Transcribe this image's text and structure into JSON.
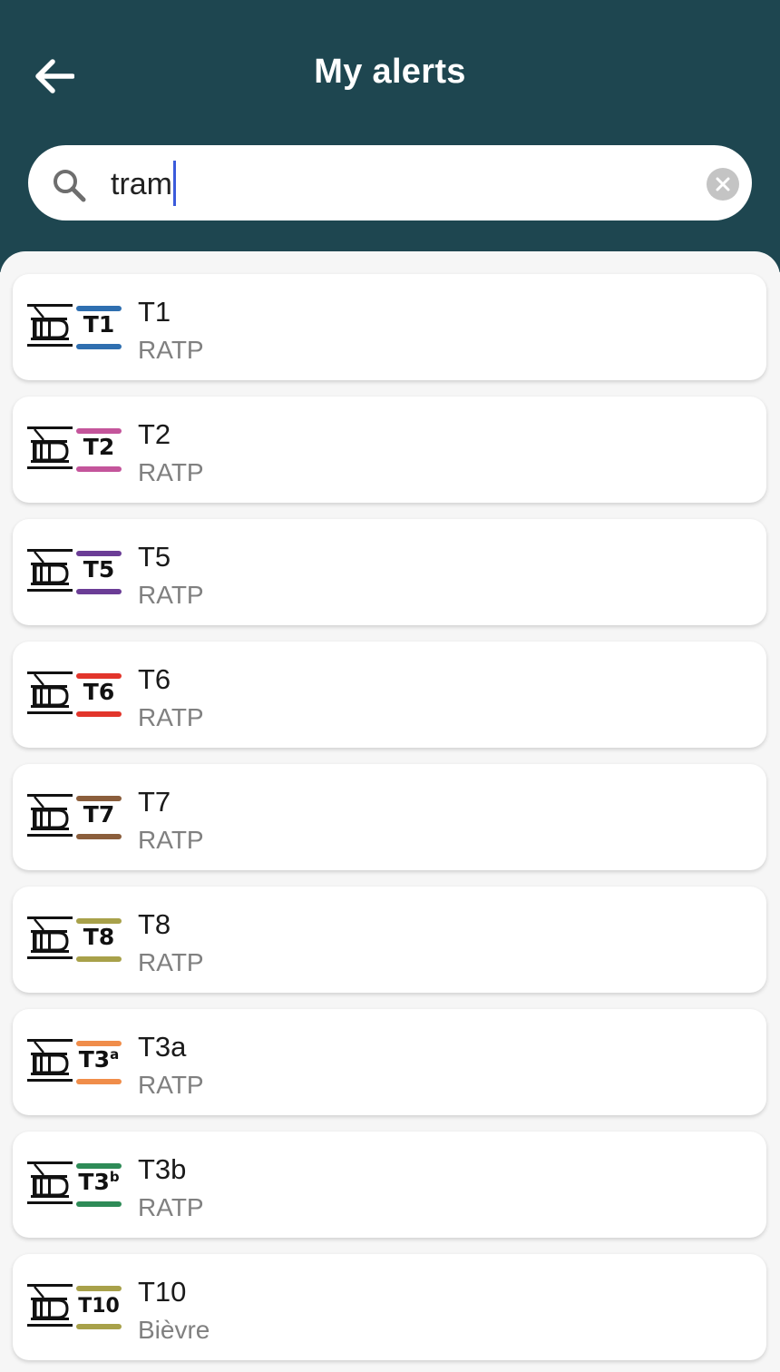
{
  "header": {
    "title": "My alerts",
    "background": "#1e4650"
  },
  "search": {
    "value": "tram",
    "placeholder": ""
  },
  "lines": [
    {
      "name": "T1",
      "code": "T1",
      "suffix": "",
      "operator": "RATP",
      "color": "#2f6fb0"
    },
    {
      "name": "T2",
      "code": "T2",
      "suffix": "",
      "operator": "RATP",
      "color": "#c4559b"
    },
    {
      "name": "T5",
      "code": "T5",
      "suffix": "",
      "operator": "RATP",
      "color": "#6b3d96"
    },
    {
      "name": "T6",
      "code": "T6",
      "suffix": "",
      "operator": "RATP",
      "color": "#e2352b"
    },
    {
      "name": "T7",
      "code": "T7",
      "suffix": "",
      "operator": "RATP",
      "color": "#8b5e3c"
    },
    {
      "name": "T8",
      "code": "T8",
      "suffix": "",
      "operator": "RATP",
      "color": "#a8a14a"
    },
    {
      "name": "T3a",
      "code": "T3",
      "suffix": "a",
      "operator": "RATP",
      "color": "#f08d4a"
    },
    {
      "name": "T3b",
      "code": "T3",
      "suffix": "b",
      "operator": "RATP",
      "color": "#2e8b57"
    },
    {
      "name": "T10",
      "code": "T10",
      "suffix": "",
      "operator": "Bièvre",
      "color": "#a8a14a"
    }
  ]
}
